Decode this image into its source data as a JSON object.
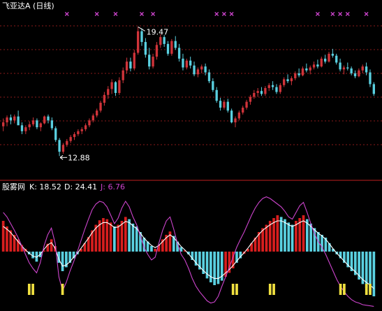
{
  "colors": {
    "background": "#000000",
    "grid": "#8b1a1a",
    "divider": "#c02020",
    "up_candle": "#d0343a",
    "down_candle": "#5ad0e0",
    "text_white": "#ffffff",
    "k_line": "#ffffff",
    "j_line": "#cc44cc",
    "marker": "#cc44cc",
    "bar_pos": "#d81e1e",
    "bar_neg": "#5ad0e0",
    "signal": "#f0e040"
  },
  "chart_data": [
    {
      "type": "candlestick",
      "title": "飞亚达A (日线)",
      "ylim": [
        12.0,
        20.2
      ],
      "annotations": [
        {
          "text": "19.47",
          "index": 36,
          "value": 19.47,
          "kind": "high"
        },
        {
          "text": "12.88",
          "index": 15,
          "value": 12.88,
          "kind": "low"
        }
      ],
      "top_markers_index": [
        17,
        25,
        30,
        37,
        40,
        57,
        59,
        61,
        84,
        88,
        90,
        92,
        97
      ],
      "candles": [
        [
          14.4,
          14.8,
          14.15,
          14.6
        ],
        [
          14.6,
          14.95,
          14.4,
          14.85
        ],
        [
          14.85,
          15.0,
          14.5,
          14.7
        ],
        [
          14.7,
          15.0,
          14.55,
          14.9
        ],
        [
          14.9,
          15.2,
          14.8,
          14.45
        ],
        [
          14.45,
          14.6,
          14.0,
          14.15
        ],
        [
          14.15,
          14.45,
          14.0,
          14.35
        ],
        [
          14.35,
          14.65,
          14.2,
          14.5
        ],
        [
          14.5,
          14.85,
          14.4,
          14.7
        ],
        [
          14.7,
          14.8,
          14.25,
          14.35
        ],
        [
          14.35,
          14.6,
          14.15,
          14.55
        ],
        [
          14.55,
          14.95,
          14.5,
          14.9
        ],
        [
          14.9,
          15.0,
          14.55,
          14.7
        ],
        [
          14.7,
          14.85,
          14.2,
          14.3
        ],
        [
          14.3,
          14.4,
          13.6,
          13.7
        ],
        [
          13.7,
          13.8,
          12.88,
          13.1
        ],
        [
          13.1,
          13.55,
          13.0,
          13.45
        ],
        [
          13.45,
          13.75,
          13.35,
          13.65
        ],
        [
          13.65,
          13.95,
          13.55,
          13.85
        ],
        [
          13.85,
          14.1,
          13.7,
          14.0
        ],
        [
          14.0,
          14.25,
          13.9,
          14.15
        ],
        [
          14.15,
          14.35,
          14.0,
          14.25
        ],
        [
          14.25,
          14.55,
          14.15,
          14.45
        ],
        [
          14.45,
          14.8,
          14.35,
          14.7
        ],
        [
          14.7,
          15.05,
          14.6,
          14.95
        ],
        [
          14.95,
          15.3,
          14.85,
          15.2
        ],
        [
          15.2,
          15.7,
          15.1,
          15.6
        ],
        [
          15.6,
          16.15,
          15.45,
          16.0
        ],
        [
          16.0,
          16.45,
          15.8,
          16.3
        ],
        [
          16.3,
          16.8,
          16.05,
          16.65
        ],
        [
          16.65,
          16.7,
          15.95,
          16.1
        ],
        [
          16.1,
          16.9,
          16.0,
          16.75
        ],
        [
          16.75,
          17.4,
          16.6,
          17.25
        ],
        [
          17.25,
          17.9,
          17.1,
          17.7
        ],
        [
          17.7,
          17.9,
          17.2,
          17.35
        ],
        [
          17.35,
          18.3,
          17.25,
          18.15
        ],
        [
          18.15,
          19.47,
          18.05,
          19.25
        ],
        [
          19.25,
          19.4,
          18.5,
          18.7
        ],
        [
          18.7,
          18.9,
          17.9,
          18.05
        ],
        [
          18.05,
          18.4,
          17.3,
          17.45
        ],
        [
          17.45,
          18.1,
          17.35,
          17.95
        ],
        [
          17.95,
          18.7,
          17.8,
          18.55
        ],
        [
          18.55,
          19.1,
          18.4,
          18.95
        ],
        [
          18.95,
          19.05,
          18.45,
          18.6
        ],
        [
          18.6,
          18.75,
          18.0,
          18.1
        ],
        [
          18.1,
          18.85,
          18.0,
          18.75
        ],
        [
          18.75,
          19.0,
          18.3,
          18.4
        ],
        [
          18.4,
          18.6,
          17.7,
          17.85
        ],
        [
          17.85,
          18.1,
          17.25,
          17.4
        ],
        [
          17.4,
          17.85,
          17.3,
          17.75
        ],
        [
          17.75,
          17.95,
          17.35,
          17.5
        ],
        [
          17.5,
          17.7,
          16.95,
          17.05
        ],
        [
          17.05,
          17.4,
          16.9,
          17.3
        ],
        [
          17.3,
          17.55,
          17.1,
          17.45
        ],
        [
          17.45,
          17.6,
          17.0,
          17.15
        ],
        [
          17.15,
          17.3,
          16.6,
          16.7
        ],
        [
          16.7,
          16.85,
          16.15,
          16.25
        ],
        [
          16.25,
          16.4,
          15.6,
          15.7
        ],
        [
          15.7,
          15.85,
          15.2,
          15.35
        ],
        [
          15.35,
          15.75,
          15.25,
          15.65
        ],
        [
          15.65,
          15.8,
          15.1,
          15.2
        ],
        [
          15.2,
          15.3,
          14.55,
          14.6
        ],
        [
          14.6,
          14.9,
          14.35,
          14.8
        ],
        [
          14.8,
          15.2,
          14.7,
          15.1
        ],
        [
          15.1,
          15.45,
          15.0,
          15.35
        ],
        [
          15.35,
          15.75,
          15.25,
          15.65
        ],
        [
          15.65,
          16.0,
          15.5,
          15.9
        ],
        [
          15.9,
          16.25,
          15.8,
          16.1
        ],
        [
          16.1,
          16.35,
          15.9,
          16.2
        ],
        [
          16.2,
          16.4,
          15.95,
          16.05
        ],
        [
          16.05,
          16.45,
          15.95,
          16.35
        ],
        [
          16.35,
          16.6,
          16.2,
          16.5
        ],
        [
          16.5,
          16.7,
          16.25,
          16.4
        ],
        [
          16.4,
          16.55,
          16.05,
          16.15
        ],
        [
          16.15,
          16.6,
          16.05,
          16.5
        ],
        [
          16.5,
          16.9,
          16.4,
          16.8
        ],
        [
          16.8,
          17.05,
          16.6,
          16.7
        ],
        [
          16.7,
          16.95,
          16.5,
          16.85
        ],
        [
          16.85,
          17.2,
          16.75,
          17.1
        ],
        [
          17.1,
          17.35,
          16.9,
          17.0
        ],
        [
          17.0,
          17.45,
          16.95,
          17.35
        ],
        [
          17.35,
          17.6,
          17.15,
          17.25
        ],
        [
          17.25,
          17.5,
          17.05,
          17.4
        ],
        [
          17.4,
          17.7,
          17.3,
          17.55
        ],
        [
          17.55,
          17.8,
          17.35,
          17.45
        ],
        [
          17.45,
          17.95,
          17.4,
          17.85
        ],
        [
          17.85,
          18.05,
          17.6,
          17.7
        ],
        [
          17.7,
          18.2,
          17.65,
          18.1
        ],
        [
          18.1,
          18.35,
          17.9,
          18.0
        ],
        [
          18.0,
          18.1,
          17.55,
          17.65
        ],
        [
          17.65,
          17.85,
          17.2,
          17.3
        ],
        [
          17.3,
          17.5,
          17.05,
          17.4
        ],
        [
          17.4,
          17.65,
          17.25,
          17.35
        ],
        [
          17.35,
          17.45,
          17.0,
          17.1
        ],
        [
          17.1,
          17.25,
          16.85,
          16.95
        ],
        [
          16.95,
          17.35,
          16.9,
          17.25
        ],
        [
          17.25,
          17.55,
          17.1,
          17.45
        ],
        [
          17.45,
          17.65,
          17.0,
          17.15
        ],
        [
          17.15,
          17.3,
          16.4,
          16.55
        ],
        [
          16.55,
          16.65,
          15.95,
          16.05
        ]
      ]
    },
    {
      "type": "indicator",
      "title": "股雾网",
      "values_text": {
        "K": "K: 18.52",
        "D": "D: 24.41",
        "J": "J: 6.76"
      },
      "ylim": [
        -1.0,
        1.0
      ],
      "bars": [
        0.55,
        0.45,
        0.38,
        0.3,
        0.22,
        0.12,
        0.05,
        -0.05,
        -0.12,
        -0.18,
        -0.1,
        0.02,
        0.14,
        0.22,
        0.1,
        -0.2,
        -0.35,
        -0.28,
        -0.2,
        -0.12,
        -0.05,
        0.05,
        0.15,
        0.26,
        0.38,
        0.48,
        0.56,
        0.6,
        0.58,
        0.52,
        0.45,
        0.48,
        0.55,
        0.62,
        0.58,
        0.5,
        0.45,
        0.35,
        0.25,
        0.18,
        0.1,
        0.05,
        0.12,
        0.22,
        0.3,
        0.36,
        0.28,
        0.18,
        0.08,
        0.02,
        -0.05,
        -0.15,
        -0.25,
        -0.32,
        -0.4,
        -0.48,
        -0.55,
        -0.6,
        -0.58,
        -0.52,
        -0.45,
        -0.38,
        -0.3,
        -0.2,
        -0.12,
        -0.04,
        0.05,
        0.15,
        0.25,
        0.35,
        0.42,
        0.48,
        0.55,
        0.6,
        0.65,
        0.62,
        0.58,
        0.52,
        0.48,
        0.55,
        0.6,
        0.65,
        0.58,
        0.5,
        0.42,
        0.35,
        0.3,
        0.25,
        0.15,
        0.05,
        -0.05,
        -0.12,
        -0.2,
        -0.28,
        -0.35,
        -0.42,
        -0.5,
        -0.58,
        -0.65,
        -0.72,
        -0.8
      ],
      "bar_colors": [
        "p",
        "p",
        "p",
        "p",
        "p",
        "p",
        "p",
        "n",
        "n",
        "n",
        "n",
        "p",
        "p",
        "p",
        "p",
        "n",
        "n",
        "n",
        "n",
        "n",
        "n",
        "p",
        "p",
        "p",
        "p",
        "p",
        "p",
        "p",
        "p",
        "p",
        "n",
        "p",
        "p",
        "p",
        "n",
        "n",
        "n",
        "n",
        "n",
        "n",
        "n",
        "p",
        "p",
        "p",
        "p",
        "p",
        "n",
        "n",
        "n",
        "p",
        "n",
        "n",
        "n",
        "n",
        "n",
        "n",
        "n",
        "n",
        "n",
        "n",
        "p",
        "p",
        "p",
        "n",
        "n",
        "p",
        "p",
        "p",
        "p",
        "p",
        "p",
        "p",
        "p",
        "p",
        "p",
        "n",
        "n",
        "n",
        "n",
        "p",
        "p",
        "p",
        "n",
        "n",
        "n",
        "n",
        "n",
        "n",
        "n",
        "n",
        "n",
        "n",
        "n",
        "n",
        "n",
        "n",
        "n",
        "n",
        "n",
        "n",
        "n"
      ],
      "k_line": [
        0.45,
        0.4,
        0.34,
        0.26,
        0.18,
        0.1,
        0.03,
        -0.03,
        -0.08,
        -0.1,
        -0.05,
        0.04,
        0.12,
        0.16,
        0.06,
        -0.14,
        -0.26,
        -0.24,
        -0.18,
        -0.1,
        -0.03,
        0.06,
        0.15,
        0.24,
        0.34,
        0.42,
        0.48,
        0.52,
        0.52,
        0.48,
        0.43,
        0.44,
        0.49,
        0.54,
        0.52,
        0.46,
        0.41,
        0.33,
        0.24,
        0.17,
        0.11,
        0.07,
        0.11,
        0.18,
        0.25,
        0.3,
        0.25,
        0.17,
        0.09,
        0.03,
        -0.04,
        -0.12,
        -0.2,
        -0.27,
        -0.34,
        -0.4,
        -0.45,
        -0.48,
        -0.48,
        -0.44,
        -0.38,
        -0.32,
        -0.25,
        -0.17,
        -0.09,
        -0.02,
        0.06,
        0.15,
        0.23,
        0.31,
        0.38,
        0.43,
        0.48,
        0.52,
        0.55,
        0.55,
        0.52,
        0.48,
        0.45,
        0.48,
        0.52,
        0.55,
        0.51,
        0.45,
        0.39,
        0.33,
        0.28,
        0.22,
        0.14,
        0.05,
        -0.03,
        -0.1,
        -0.17,
        -0.24,
        -0.3,
        -0.36,
        -0.43,
        -0.5,
        -0.55,
        -0.6,
        -0.66
      ],
      "j_line": [
        0.7,
        0.62,
        0.5,
        0.38,
        0.25,
        0.1,
        -0.05,
        -0.2,
        -0.3,
        -0.38,
        -0.2,
        0.1,
        0.3,
        0.42,
        0.15,
        -0.45,
        -0.7,
        -0.55,
        -0.35,
        -0.18,
        0.0,
        0.2,
        0.4,
        0.58,
        0.75,
        0.85,
        0.9,
        0.88,
        0.8,
        0.65,
        0.5,
        0.6,
        0.78,
        0.9,
        0.8,
        0.62,
        0.48,
        0.28,
        0.08,
        -0.05,
        -0.15,
        -0.1,
        0.15,
        0.38,
        0.55,
        0.62,
        0.4,
        0.15,
        -0.05,
        -0.15,
        -0.3,
        -0.48,
        -0.62,
        -0.72,
        -0.8,
        -0.88,
        -0.92,
        -0.9,
        -0.8,
        -0.62,
        -0.45,
        -0.28,
        -0.1,
        0.08,
        0.22,
        0.35,
        0.5,
        0.65,
        0.78,
        0.88,
        0.95,
        0.98,
        0.95,
        0.9,
        0.85,
        0.8,
        0.72,
        0.62,
        0.58,
        0.7,
        0.82,
        0.88,
        0.7,
        0.5,
        0.32,
        0.18,
        0.08,
        -0.05,
        -0.2,
        -0.35,
        -0.5,
        -0.62,
        -0.72,
        -0.8,
        -0.86,
        -0.9,
        -0.92,
        -0.95,
        -0.96,
        -0.97,
        -0.98
      ],
      "yellow_signal_index": [
        7,
        8,
        16,
        62,
        63,
        72,
        73,
        91,
        92,
        98,
        99
      ]
    }
  ]
}
